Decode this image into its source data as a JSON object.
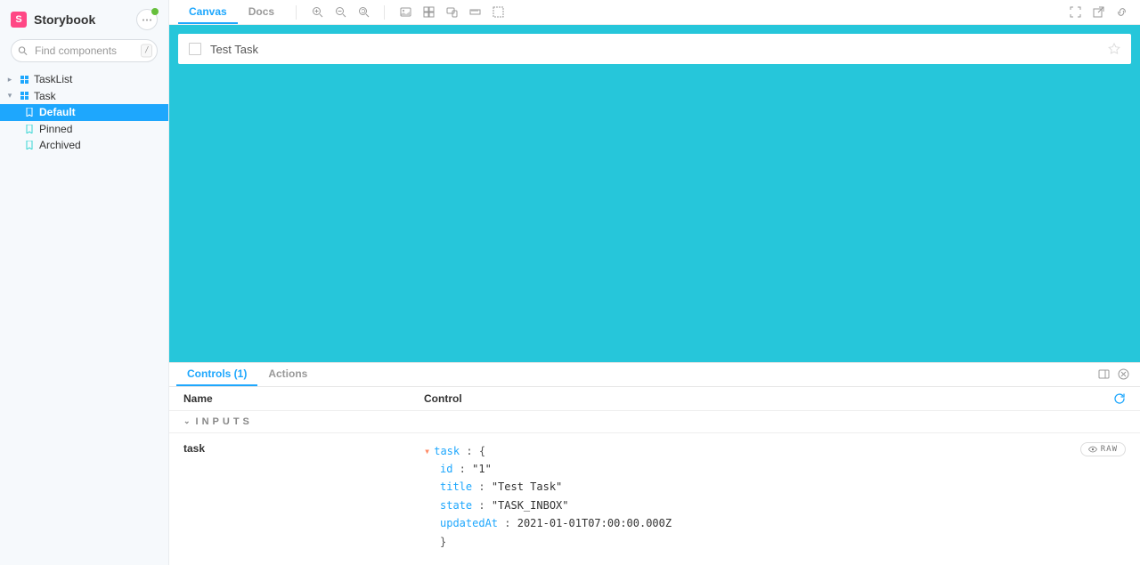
{
  "brand": {
    "name": "Storybook",
    "logo_letter": "S"
  },
  "search": {
    "placeholder": "Find components",
    "shortcut": "/"
  },
  "sidebar": {
    "items": [
      {
        "label": "TaskList",
        "kind": "group"
      },
      {
        "label": "Task",
        "kind": "group"
      },
      {
        "label": "Default",
        "kind": "story",
        "active": true
      },
      {
        "label": "Pinned",
        "kind": "story"
      },
      {
        "label": "Archived",
        "kind": "story"
      }
    ]
  },
  "toolbar": {
    "tabs": [
      {
        "label": "Canvas",
        "active": true
      },
      {
        "label": "Docs"
      }
    ]
  },
  "canvas": {
    "task": {
      "title": "Test Task"
    },
    "background": "#26c6da"
  },
  "addons": {
    "tabs": [
      {
        "label": "Controls (1)",
        "active": true
      },
      {
        "label": "Actions"
      }
    ],
    "columns": {
      "name": "Name",
      "control": "Control"
    },
    "section": "INPUTS",
    "control_name": "task",
    "raw_button": "RAW",
    "json": {
      "root_key": "task",
      "fields": [
        {
          "key": "id",
          "value": "\"1\""
        },
        {
          "key": "title",
          "value": "\"Test Task\""
        },
        {
          "key": "state",
          "value": "\"TASK_INBOX\""
        },
        {
          "key": "updatedAt",
          "value": "2021-01-01T07:00:00.000Z"
        }
      ]
    }
  }
}
